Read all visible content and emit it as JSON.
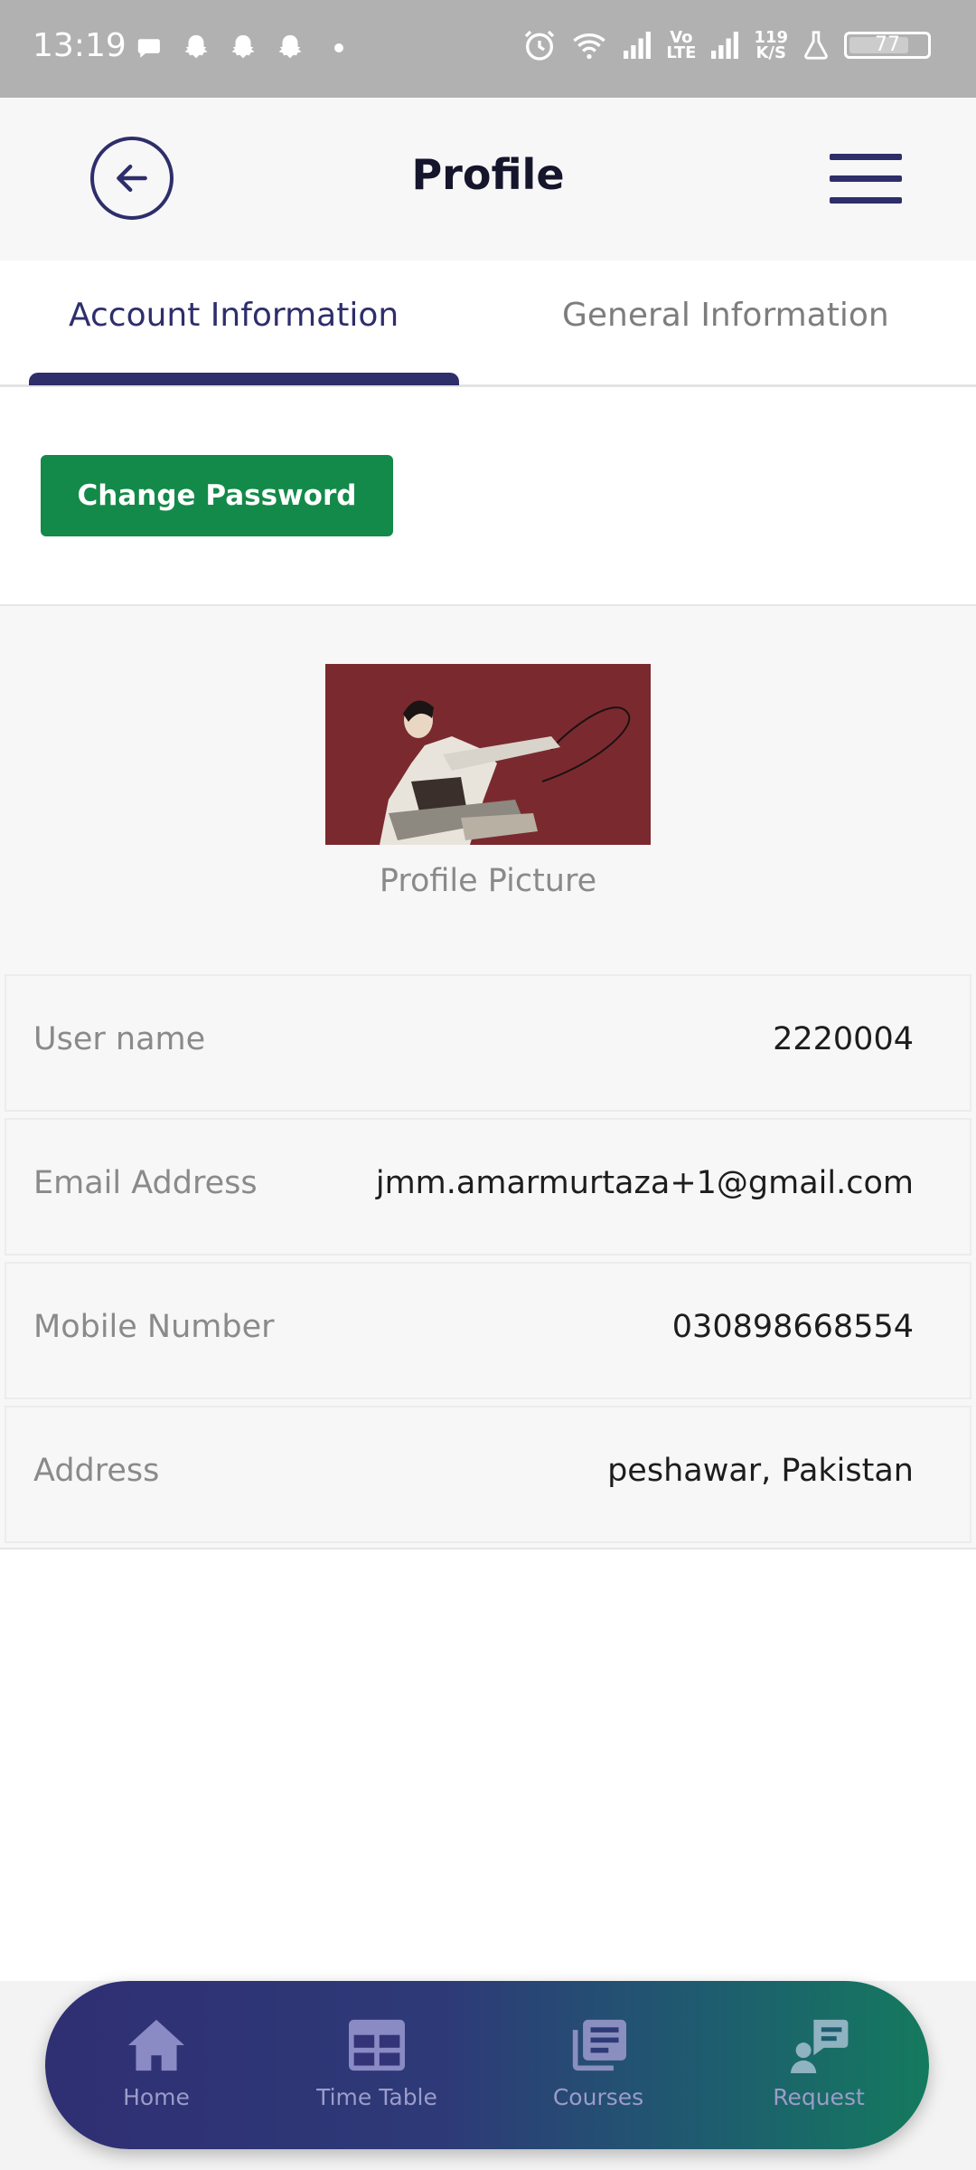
{
  "status_bar": {
    "time": "13:19",
    "network_speed_top": "119",
    "network_speed_bottom": "K/S",
    "volte_top": "Vo",
    "volte_bottom": "LTE",
    "battery": "77"
  },
  "header": {
    "title": "Profile"
  },
  "tabs": [
    {
      "label": "Account Information"
    },
    {
      "label": "General Information"
    }
  ],
  "actions": {
    "change_password_label": "Change Password"
  },
  "profile": {
    "picture_caption": "Profile Picture",
    "fields": [
      {
        "label": "User name",
        "value": "2220004"
      },
      {
        "label": "Email Address",
        "value": "jmm.amarmurtaza+1@gmail.com"
      },
      {
        "label": "Mobile Number",
        "value": "030898668554"
      },
      {
        "label": "Address",
        "value": "peshawar, Pakistan"
      }
    ]
  },
  "bottom_nav": [
    {
      "label": "Home",
      "icon": "home-icon"
    },
    {
      "label": "Time Table",
      "icon": "table-icon"
    },
    {
      "label": "Courses",
      "icon": "courses-icon"
    },
    {
      "label": "Request",
      "icon": "request-icon"
    }
  ],
  "colors": {
    "accent": "#2e2e6b",
    "button_green": "#138a49",
    "status_bar": "#b1b1b1"
  }
}
